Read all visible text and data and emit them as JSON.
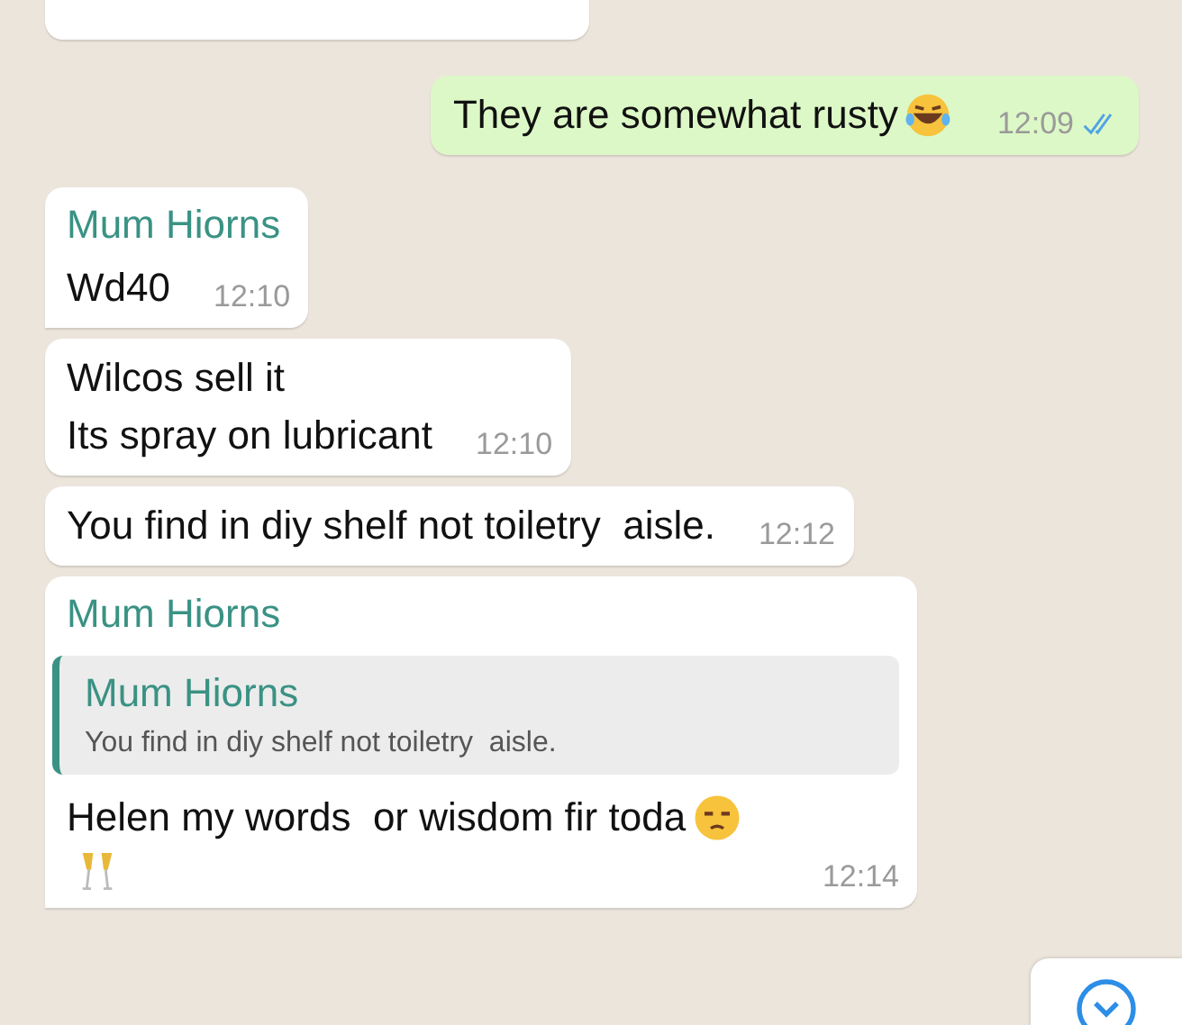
{
  "messages": [
    {
      "kind": "cut",
      "outgoing": false
    },
    {
      "kind": "text",
      "outgoing": true,
      "lines": [
        {
          "text": "They are somewhat rusty",
          "kind": "laughing"
        }
      ],
      "time": "12:09",
      "read": true
    },
    {
      "kind": "text",
      "outgoing": false,
      "sender": "Mum Hiorns",
      "tail": true,
      "lines": [
        {
          "text": "Wd40"
        }
      ],
      "time": "12:10"
    },
    {
      "kind": "text",
      "outgoing": false,
      "lines": [
        {
          "text": "Wilcos sell it"
        },
        {
          "text": "Its spray on lubricant"
        }
      ],
      "time": "12:10"
    },
    {
      "kind": "text",
      "outgoing": false,
      "lines": [
        {
          "text": "You find in diy shelf not toiletry  aisle."
        }
      ],
      "time": "12:12"
    },
    {
      "kind": "text",
      "outgoing": false,
      "sender": "Mum Hiorns",
      "tail": true,
      "quote": {
        "sender": "Mum Hiorns",
        "text": "You find in diy shelf not toiletry  aisle."
      },
      "lines": [
        {
          "text": "Helen my words  or wisdom fir toda",
          "kind": "unamused"
        },
        {
          "kind": "champagne"
        }
      ],
      "time": "12:14"
    }
  ],
  "scroll_button": {
    "kind": "down"
  }
}
